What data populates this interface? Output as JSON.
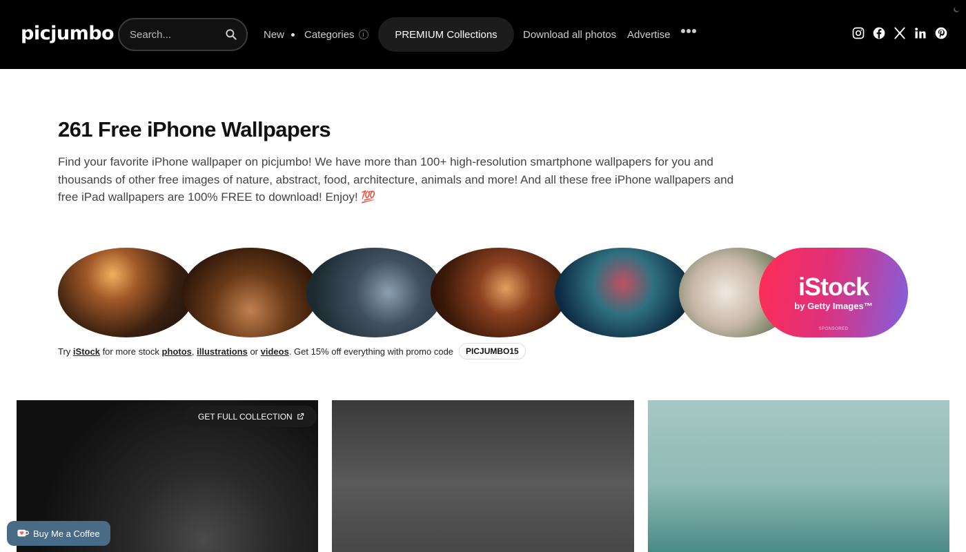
{
  "header": {
    "logo": "picjumbo",
    "search_placeholder": "Search...",
    "nav_new": "New",
    "nav_categories": "Categories",
    "nav_categories_badge": "i",
    "premium": "PREMIUM Collections",
    "nav_download": "Download all photos",
    "nav_advertise": "Advertise",
    "socials": [
      "instagram-icon",
      "facebook-icon",
      "x-icon",
      "linkedin-icon",
      "pinterest-icon"
    ]
  },
  "intro": {
    "title": "261 Free iPhone Wallpapers",
    "description": "Find your favorite iPhone wallpaper on picjumbo! We have more than 100+ high-resolution smartphone wallpapers for you and thousands of other free images of nature, abstract, food, architecture, animals and more! And all these free iPhone wallpapers and free iPad wallpapers are 100% FREE to download! Enjoy! 💯"
  },
  "istock_banner": {
    "brand": "iStock",
    "sub": "by Getty Images™",
    "sponsored": "SPONSORED"
  },
  "promo": {
    "try": "Try",
    "istock": "iStock",
    "for_more": "for more stock",
    "photos": "photos",
    "comma": ",",
    "illustrations": "illustrations",
    "or": "or",
    "videos": "videos",
    "tail": ". Get 15% off everything with promo code",
    "code": "PICJUMBO15"
  },
  "gallery": {
    "full_collection": "GET FULL COLLECTION"
  },
  "coffee": {
    "label": "Buy Me a Coffee"
  },
  "colors": {
    "header_bg": "#000000",
    "coffee_bg": "#4a6b86",
    "istock_gradient_start": "#ff2d55",
    "istock_gradient_end": "#8060e0"
  }
}
